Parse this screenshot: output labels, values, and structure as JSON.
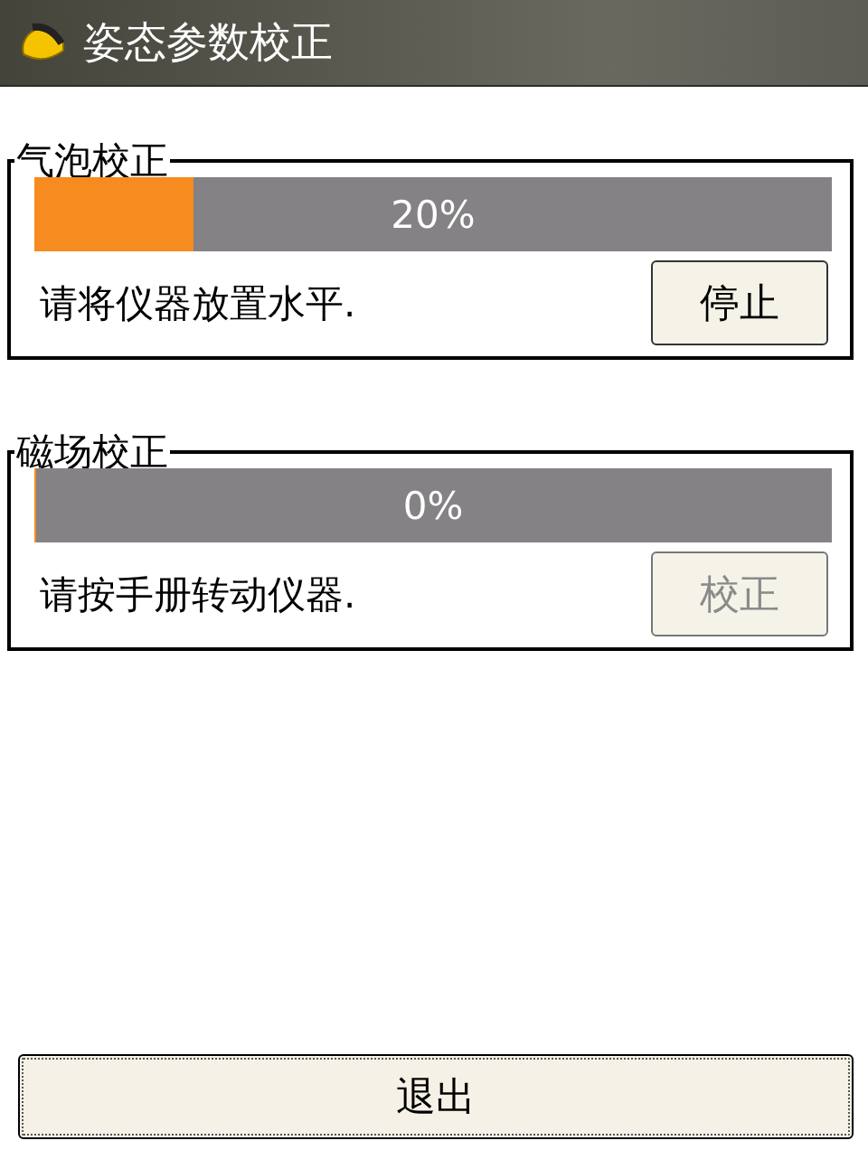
{
  "window": {
    "title": "姿态参数校正"
  },
  "groups": [
    {
      "title": "气泡校正",
      "level": 0.2,
      "reading": "20%",
      "message": "请将仪器放置水平.",
      "button": {
        "label": "停止",
        "disabled": false
      }
    },
    {
      "title": "磁场校正",
      "level": 0,
      "reading": "0%",
      "message": "请按手册转动仪器.",
      "button": {
        "label": "校正",
        "disabled": true
      }
    }
  ],
  "exit_button": "退出"
}
